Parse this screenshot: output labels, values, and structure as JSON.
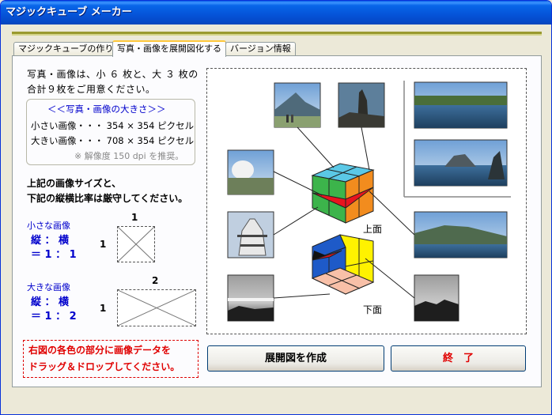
{
  "window": {
    "title": "マジックキューブ メーカー"
  },
  "tabs": [
    {
      "label": "マジックキューブの作り方"
    },
    {
      "label": "写真・画像を展開図化する"
    },
    {
      "label": "バージョン情報"
    }
  ],
  "intro": {
    "line1": "写真・画像は、小 ６ 枚と、大 ３ 枚の",
    "line2": "合計９枚をご用意ください。"
  },
  "size_box": {
    "heading": "＜＜写真・画像の大きさ＞＞",
    "small": "小さい画像・・・ 354 × 354 ピクセル",
    "large": "大きい画像・・・ 708 × 354 ピクセル",
    "resolution": "※ 解像度 150 dpi を推奨。"
  },
  "ratio_notice": {
    "line1": "上記の画像サイズと、",
    "line2": "下記の縦横比率は厳守してください。"
  },
  "small_image": {
    "label": "小さな画像",
    "axes": "縦 ： 横",
    "ratio": "＝ 1 ： 1",
    "top_num": "1",
    "side_num": "1"
  },
  "large_image": {
    "label": "大きな画像",
    "axes": "縦 ： 横",
    "ratio": "＝ 1 ： 2",
    "top_num": "2",
    "side_num": "1"
  },
  "drag_note": {
    "line1": "右図の各色の部分に画像データを",
    "line2": "ドラッグ＆ドロップしてください。"
  },
  "diagram": {
    "top_label": "上面",
    "bottom_label": "下面"
  },
  "buttons": {
    "make": "展開図を作成",
    "quit": "終　了"
  },
  "colors": {
    "cube_top": "#5bc8e6",
    "cube_front_left": "#3cb44b",
    "cube_front_right": "#f28c1e",
    "cube_red": "#e8141e",
    "cube_blue": "#1e5ac8",
    "cube_yellow": "#fff200",
    "cube_pink": "#f8c0a8",
    "cube_dark": "#111111"
  }
}
